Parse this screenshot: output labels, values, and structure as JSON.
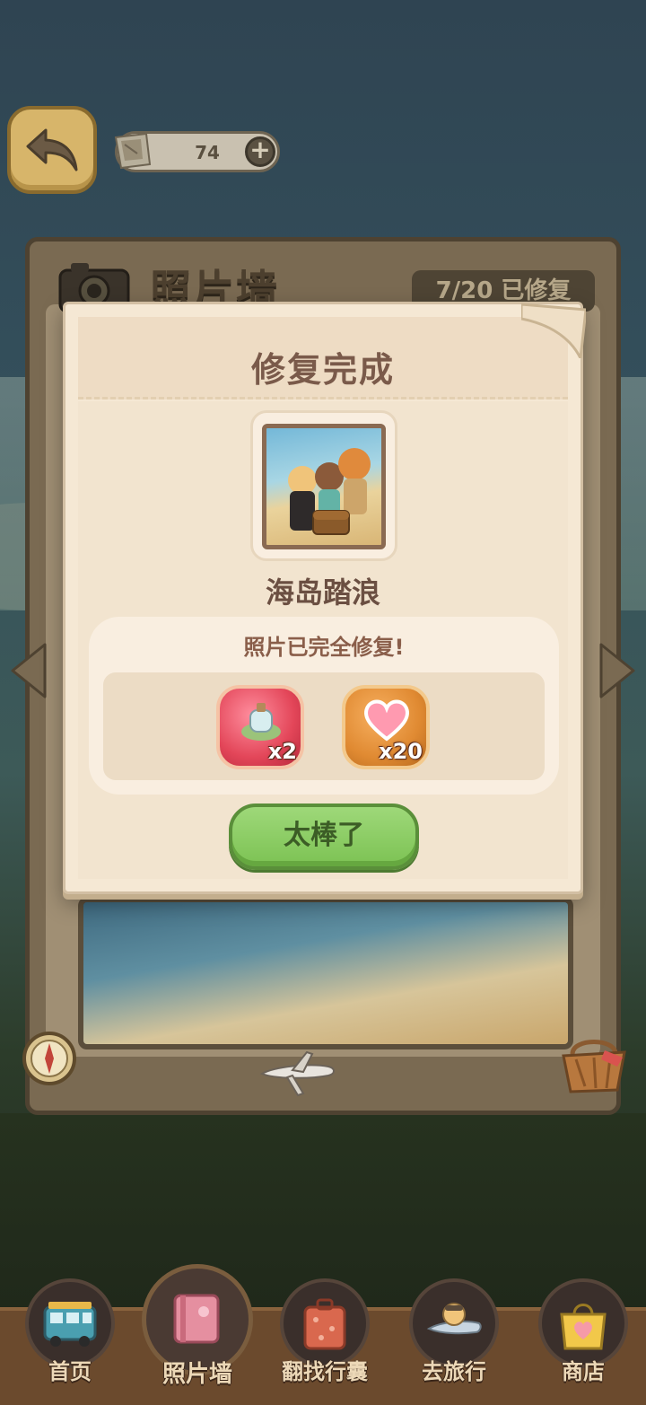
{
  "currency": {
    "value": "74",
    "plus": "+"
  },
  "album": {
    "title": "照片墙",
    "progress": "7/20 已修复"
  },
  "dialog": {
    "title": "修复完成",
    "photo_name": "海岛踏浪",
    "message": "照片已完全修复!",
    "rewards": [
      {
        "icon": "bottle-icon",
        "qty": "x2"
      },
      {
        "icon": "heart-icon",
        "qty": "x20"
      }
    ],
    "confirm_label": "太棒了"
  },
  "nav": [
    {
      "label": "首页",
      "icon": "bus-icon"
    },
    {
      "label": "照片墙",
      "icon": "album-book-icon",
      "active": true
    },
    {
      "label": "翻找行囊",
      "icon": "suitcase-icon"
    },
    {
      "label": "去旅行",
      "icon": "pilot-plane-icon"
    },
    {
      "label": "商店",
      "icon": "shopping-bag-icon"
    }
  ],
  "colors": {
    "accent_green": "#7cc253",
    "dialog_bg": "#f5e8d4",
    "title_brown": "#7a5a4a"
  }
}
